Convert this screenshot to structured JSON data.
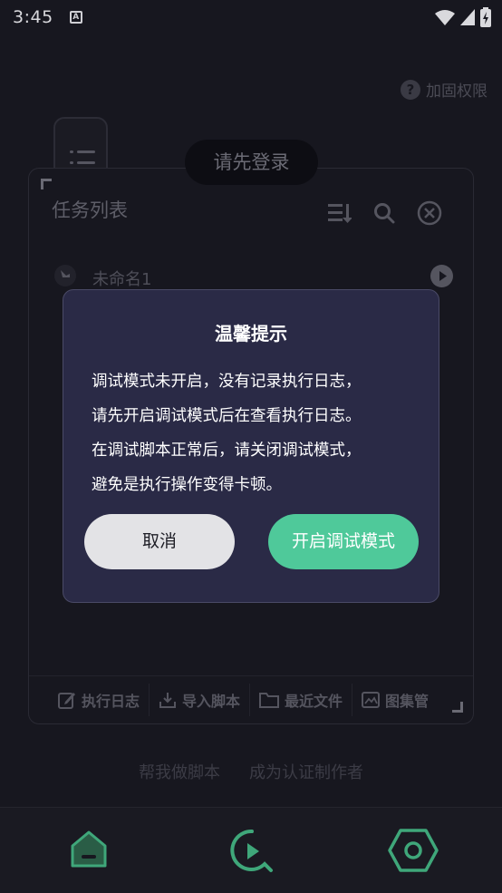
{
  "status_bar": {
    "time": "3:45",
    "badge": "A"
  },
  "header": {
    "permission_label": "加固权限"
  },
  "toast": {
    "text": "请先登录"
  },
  "task_panel": {
    "title": "任务列表",
    "tasks": [
      {
        "name": "未命名1"
      }
    ],
    "footer": [
      {
        "label": "执行日志",
        "icon": "edit-icon"
      },
      {
        "label": "导入脚本",
        "icon": "download-icon"
      },
      {
        "label": "最近文件",
        "icon": "folder-icon"
      },
      {
        "label": "图集管",
        "icon": "image-icon"
      }
    ]
  },
  "bottom_links": {
    "make_script": "帮我做脚本",
    "become_author": "成为认证制作者"
  },
  "dialog": {
    "title": "温馨提示",
    "lines": [
      "调试模式未开启，没有记录执行日志，",
      "请先开启调试模式后在查看执行日志。",
      "在调试脚本正常后，请关闭调试模式，",
      "避免是执行操作变得卡顿。"
    ],
    "cancel_label": "取消",
    "confirm_label": "开启调试模式"
  },
  "colors": {
    "accent": "#4fc99a",
    "dialog_bg": "#2a2a46",
    "background": "#17171f"
  }
}
